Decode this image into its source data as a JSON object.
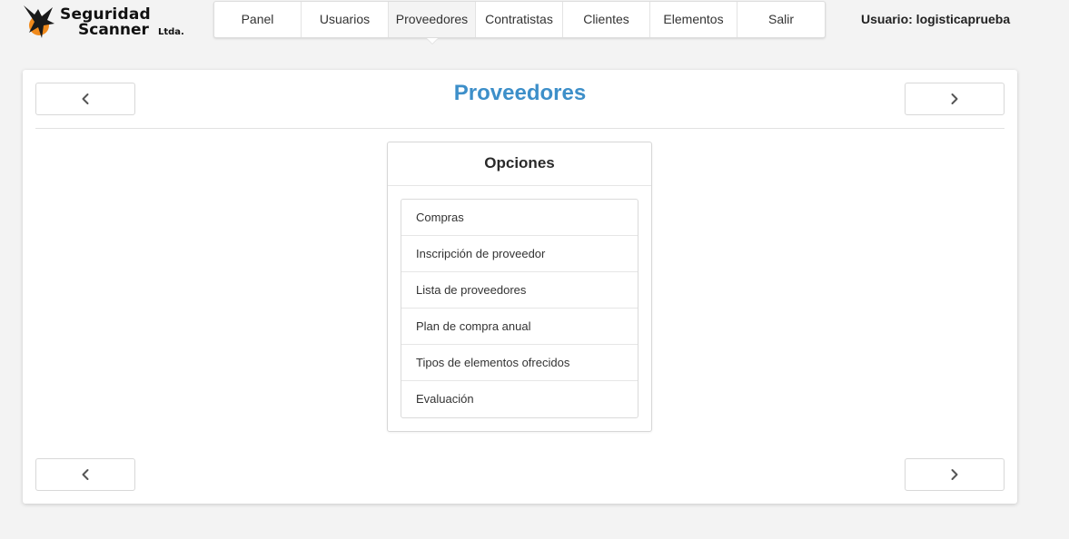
{
  "brand": {
    "line1": "Seguridad",
    "line2": "Scanner",
    "suffix": "Ltda."
  },
  "nav": {
    "items": [
      {
        "label": "Panel"
      },
      {
        "label": "Usuarios"
      },
      {
        "label": "Proveedores"
      },
      {
        "label": "Contratistas"
      },
      {
        "label": "Clientes"
      },
      {
        "label": "Elementos"
      },
      {
        "label": "Salir"
      }
    ],
    "active": "Proveedores"
  },
  "user": {
    "label": "Usuario: logisticaprueba"
  },
  "page": {
    "title": "Proveedores"
  },
  "options": {
    "heading": "Opciones",
    "items": [
      {
        "label": "Compras"
      },
      {
        "label": "Inscripción de proveedor"
      },
      {
        "label": "Lista de proveedores"
      },
      {
        "label": "Plan de compra anual"
      },
      {
        "label": "Tipos de elementos ofrecidos"
      },
      {
        "label": "Evaluación"
      }
    ]
  },
  "colors": {
    "title": "#3d8fc9",
    "logo_accent": "#f08a1c"
  },
  "icons": {
    "prev": "chevron-left-icon",
    "next": "chevron-right-icon"
  }
}
